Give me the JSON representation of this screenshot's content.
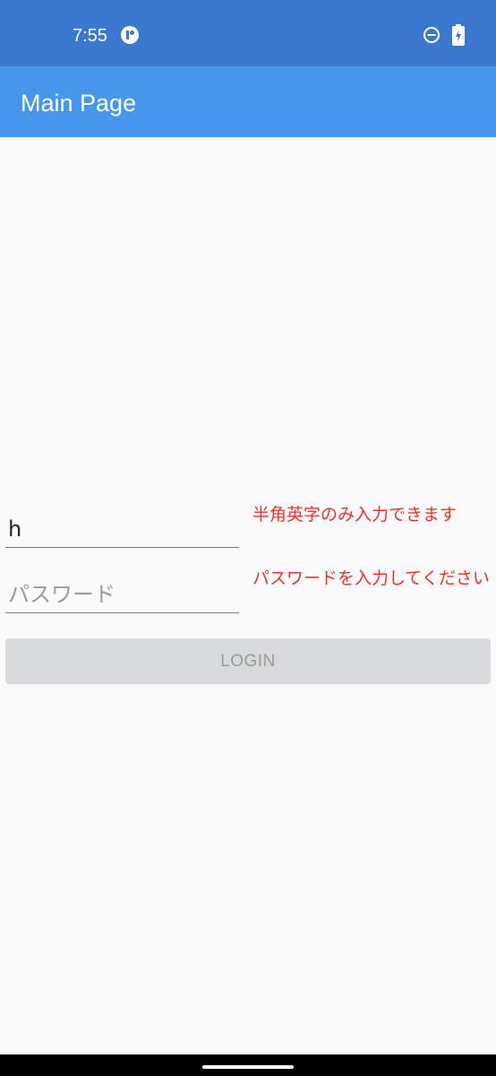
{
  "status_bar": {
    "time": "7:55",
    "icons": [
      "notification-icon",
      "do-not-disturb-icon",
      "battery-charging-icon"
    ]
  },
  "app_bar": {
    "title": "Main Page"
  },
  "login_form": {
    "username": {
      "value": "h",
      "error": "半角英字のみ入力できます"
    },
    "password": {
      "placeholder": "パスワード",
      "error": "パスワードを入力してください"
    },
    "login_button": {
      "label": "LOGIN",
      "enabled": false
    }
  },
  "colors": {
    "status_bar": "#3a77cf",
    "app_bar": "#4796ed",
    "error": "#e0332c",
    "disabled_button": "#d8dadb"
  }
}
